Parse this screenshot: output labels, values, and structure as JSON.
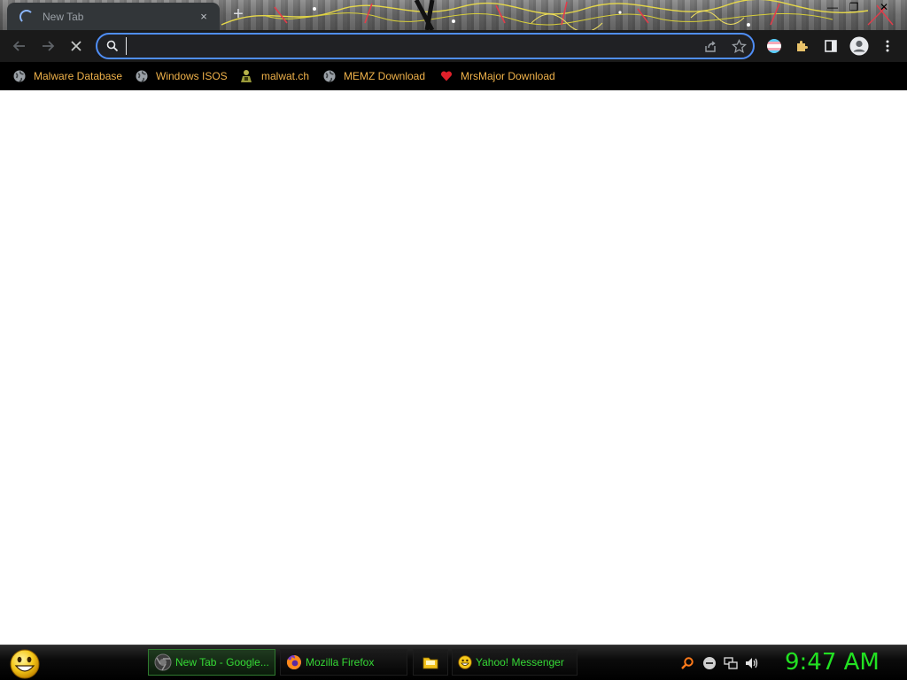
{
  "browser": {
    "tab": {
      "title": "New Tab",
      "close_glyph": "×"
    },
    "new_tab_glyph": "+",
    "window_controls": {
      "minimize": "—",
      "restore": "❐",
      "close": "✕"
    },
    "omnibox": {
      "value": "",
      "placeholder": ""
    },
    "bookmarks": [
      {
        "label": "Malware Database",
        "icon": "globe-icon"
      },
      {
        "label": "Windows ISOS",
        "icon": "globe-icon"
      },
      {
        "label": "malwat.ch",
        "icon": "malwatch-icon"
      },
      {
        "label": "MEMZ Download",
        "icon": "globe-icon"
      },
      {
        "label": "MrsMajor Download",
        "icon": "heart-icon"
      }
    ]
  },
  "taskbar": {
    "tasks": [
      {
        "label": "New Tab - Google...",
        "icon": "chrome-icon",
        "active": true
      },
      {
        "label": "Mozilla Firefox",
        "icon": "firefox-icon",
        "active": false
      },
      {
        "label": "",
        "icon": "folder-icon",
        "active": false
      },
      {
        "label": "Yahoo! Messenger",
        "icon": "yahoo-messenger-icon",
        "active": false
      }
    ],
    "clock": "9:47 AM"
  },
  "colors": {
    "omnibox_border": "#4f8ef7",
    "bookmark_text": "#f0b24a",
    "taskbar_text": "#35d935",
    "clock": "#22e022"
  }
}
